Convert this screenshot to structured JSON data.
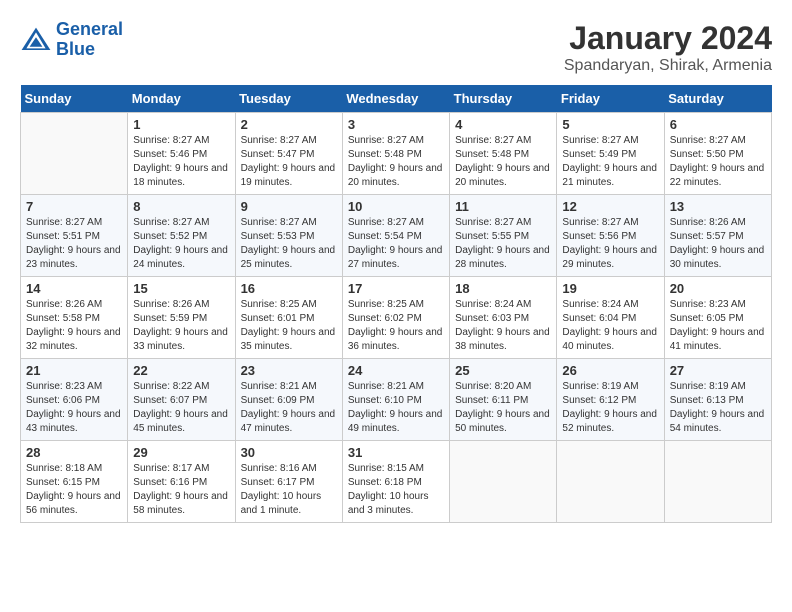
{
  "header": {
    "logo_text_general": "General",
    "logo_text_blue": "Blue",
    "title": "January 2024",
    "subtitle": "Spandaryan, Shirak, Armenia"
  },
  "calendar": {
    "days_of_week": [
      "Sunday",
      "Monday",
      "Tuesday",
      "Wednesday",
      "Thursday",
      "Friday",
      "Saturday"
    ],
    "weeks": [
      [
        {
          "day": "",
          "empty": true
        },
        {
          "day": "1",
          "sunrise": "Sunrise: 8:27 AM",
          "sunset": "Sunset: 5:46 PM",
          "daylight": "Daylight: 9 hours and 18 minutes."
        },
        {
          "day": "2",
          "sunrise": "Sunrise: 8:27 AM",
          "sunset": "Sunset: 5:47 PM",
          "daylight": "Daylight: 9 hours and 19 minutes."
        },
        {
          "day": "3",
          "sunrise": "Sunrise: 8:27 AM",
          "sunset": "Sunset: 5:48 PM",
          "daylight": "Daylight: 9 hours and 20 minutes."
        },
        {
          "day": "4",
          "sunrise": "Sunrise: 8:27 AM",
          "sunset": "Sunset: 5:48 PM",
          "daylight": "Daylight: 9 hours and 20 minutes."
        },
        {
          "day": "5",
          "sunrise": "Sunrise: 8:27 AM",
          "sunset": "Sunset: 5:49 PM",
          "daylight": "Daylight: 9 hours and 21 minutes."
        },
        {
          "day": "6",
          "sunrise": "Sunrise: 8:27 AM",
          "sunset": "Sunset: 5:50 PM",
          "daylight": "Daylight: 9 hours and 22 minutes."
        }
      ],
      [
        {
          "day": "7",
          "sunrise": "Sunrise: 8:27 AM",
          "sunset": "Sunset: 5:51 PM",
          "daylight": "Daylight: 9 hours and 23 minutes."
        },
        {
          "day": "8",
          "sunrise": "Sunrise: 8:27 AM",
          "sunset": "Sunset: 5:52 PM",
          "daylight": "Daylight: 9 hours and 24 minutes."
        },
        {
          "day": "9",
          "sunrise": "Sunrise: 8:27 AM",
          "sunset": "Sunset: 5:53 PM",
          "daylight": "Daylight: 9 hours and 25 minutes."
        },
        {
          "day": "10",
          "sunrise": "Sunrise: 8:27 AM",
          "sunset": "Sunset: 5:54 PM",
          "daylight": "Daylight: 9 hours and 27 minutes."
        },
        {
          "day": "11",
          "sunrise": "Sunrise: 8:27 AM",
          "sunset": "Sunset: 5:55 PM",
          "daylight": "Daylight: 9 hours and 28 minutes."
        },
        {
          "day": "12",
          "sunrise": "Sunrise: 8:27 AM",
          "sunset": "Sunset: 5:56 PM",
          "daylight": "Daylight: 9 hours and 29 minutes."
        },
        {
          "day": "13",
          "sunrise": "Sunrise: 8:26 AM",
          "sunset": "Sunset: 5:57 PM",
          "daylight": "Daylight: 9 hours and 30 minutes."
        }
      ],
      [
        {
          "day": "14",
          "sunrise": "Sunrise: 8:26 AM",
          "sunset": "Sunset: 5:58 PM",
          "daylight": "Daylight: 9 hours and 32 minutes."
        },
        {
          "day": "15",
          "sunrise": "Sunrise: 8:26 AM",
          "sunset": "Sunset: 5:59 PM",
          "daylight": "Daylight: 9 hours and 33 minutes."
        },
        {
          "day": "16",
          "sunrise": "Sunrise: 8:25 AM",
          "sunset": "Sunset: 6:01 PM",
          "daylight": "Daylight: 9 hours and 35 minutes."
        },
        {
          "day": "17",
          "sunrise": "Sunrise: 8:25 AM",
          "sunset": "Sunset: 6:02 PM",
          "daylight": "Daylight: 9 hours and 36 minutes."
        },
        {
          "day": "18",
          "sunrise": "Sunrise: 8:24 AM",
          "sunset": "Sunset: 6:03 PM",
          "daylight": "Daylight: 9 hours and 38 minutes."
        },
        {
          "day": "19",
          "sunrise": "Sunrise: 8:24 AM",
          "sunset": "Sunset: 6:04 PM",
          "daylight": "Daylight: 9 hours and 40 minutes."
        },
        {
          "day": "20",
          "sunrise": "Sunrise: 8:23 AM",
          "sunset": "Sunset: 6:05 PM",
          "daylight": "Daylight: 9 hours and 41 minutes."
        }
      ],
      [
        {
          "day": "21",
          "sunrise": "Sunrise: 8:23 AM",
          "sunset": "Sunset: 6:06 PM",
          "daylight": "Daylight: 9 hours and 43 minutes."
        },
        {
          "day": "22",
          "sunrise": "Sunrise: 8:22 AM",
          "sunset": "Sunset: 6:07 PM",
          "daylight": "Daylight: 9 hours and 45 minutes."
        },
        {
          "day": "23",
          "sunrise": "Sunrise: 8:21 AM",
          "sunset": "Sunset: 6:09 PM",
          "daylight": "Daylight: 9 hours and 47 minutes."
        },
        {
          "day": "24",
          "sunrise": "Sunrise: 8:21 AM",
          "sunset": "Sunset: 6:10 PM",
          "daylight": "Daylight: 9 hours and 49 minutes."
        },
        {
          "day": "25",
          "sunrise": "Sunrise: 8:20 AM",
          "sunset": "Sunset: 6:11 PM",
          "daylight": "Daylight: 9 hours and 50 minutes."
        },
        {
          "day": "26",
          "sunrise": "Sunrise: 8:19 AM",
          "sunset": "Sunset: 6:12 PM",
          "daylight": "Daylight: 9 hours and 52 minutes."
        },
        {
          "day": "27",
          "sunrise": "Sunrise: 8:19 AM",
          "sunset": "Sunset: 6:13 PM",
          "daylight": "Daylight: 9 hours and 54 minutes."
        }
      ],
      [
        {
          "day": "28",
          "sunrise": "Sunrise: 8:18 AM",
          "sunset": "Sunset: 6:15 PM",
          "daylight": "Daylight: 9 hours and 56 minutes."
        },
        {
          "day": "29",
          "sunrise": "Sunrise: 8:17 AM",
          "sunset": "Sunset: 6:16 PM",
          "daylight": "Daylight: 9 hours and 58 minutes."
        },
        {
          "day": "30",
          "sunrise": "Sunrise: 8:16 AM",
          "sunset": "Sunset: 6:17 PM",
          "daylight": "Daylight: 10 hours and 1 minute."
        },
        {
          "day": "31",
          "sunrise": "Sunrise: 8:15 AM",
          "sunset": "Sunset: 6:18 PM",
          "daylight": "Daylight: 10 hours and 3 minutes."
        },
        {
          "day": "",
          "empty": true
        },
        {
          "day": "",
          "empty": true
        },
        {
          "day": "",
          "empty": true
        }
      ]
    ]
  }
}
